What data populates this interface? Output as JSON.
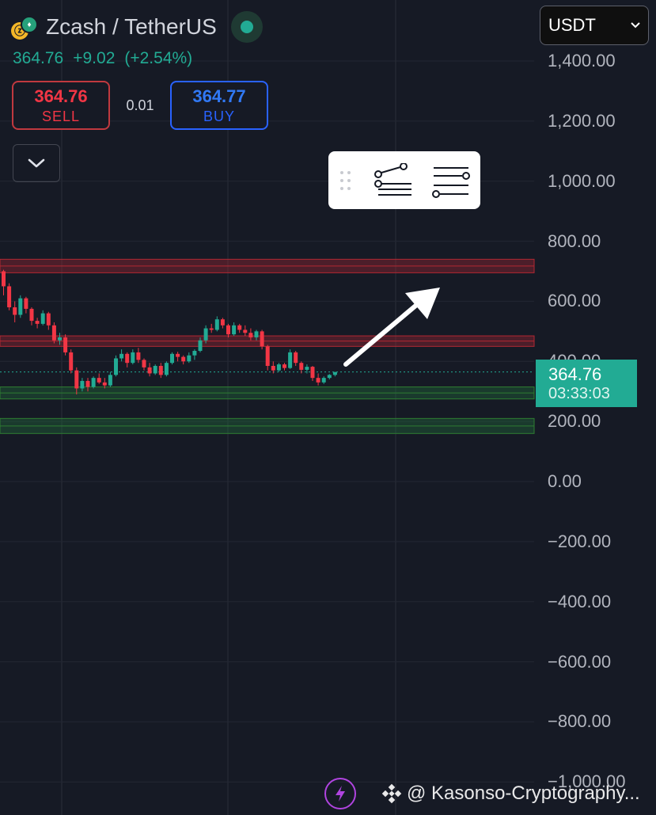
{
  "header": {
    "pair_title": "Zcash / TetherUS",
    "icons": {
      "base_coin": "zcash-coin-icon",
      "quote_coin": "tether-coin-icon",
      "market_status": "market-open-dot-icon"
    }
  },
  "price_line": {
    "last": "364.76",
    "change": "+9.02",
    "change_pct": "(+2.54%)"
  },
  "trade": {
    "sell_price": "364.76",
    "sell_label": "SELL",
    "spread": "0.01",
    "buy_price": "364.77",
    "buy_label": "BUY"
  },
  "currency_select": {
    "value": "USDT"
  },
  "y_axis": {
    "labels": [
      "1,400.00",
      "1,200.00",
      "1,000.00",
      "800.00",
      "600.00",
      "400.00",
      "200.00",
      "0.00",
      "−200.00",
      "−400.00",
      "−600.00",
      "−800.00",
      "−1,000.00"
    ]
  },
  "last_price_tag": {
    "price": "364.76",
    "countdown": "03:33:03"
  },
  "colors": {
    "up": "#22ab94",
    "down": "#f23645",
    "background": "#161a25",
    "buy_border": "#2962ff",
    "sell_border": "#c0393f"
  },
  "footer": {
    "watermark": "@ Kasonso-Cryptography..."
  },
  "chart_data": {
    "type": "candlestick",
    "ylim": [
      -1000,
      1400
    ],
    "last_price": 364.76,
    "resistance_zones": [
      [
        695,
        740
      ],
      [
        450,
        485
      ]
    ],
    "support_zones": [
      [
        275,
        315
      ],
      [
        160,
        210
      ]
    ],
    "candles": [
      [
        700,
        705,
        620,
        650
      ],
      [
        650,
        660,
        570,
        580
      ],
      [
        580,
        600,
        530,
        555
      ],
      [
        555,
        620,
        545,
        610
      ],
      [
        610,
        615,
        560,
        575
      ],
      [
        575,
        580,
        520,
        535
      ],
      [
        535,
        545,
        510,
        525
      ],
      [
        525,
        570,
        520,
        560
      ],
      [
        560,
        565,
        505,
        520
      ],
      [
        520,
        530,
        460,
        470
      ],
      [
        470,
        495,
        455,
        480
      ],
      [
        480,
        490,
        420,
        430
      ],
      [
        430,
        440,
        360,
        370
      ],
      [
        370,
        380,
        290,
        310
      ],
      [
        310,
        345,
        300,
        335
      ],
      [
        335,
        345,
        300,
        315
      ],
      [
        315,
        350,
        310,
        345
      ],
      [
        345,
        360,
        325,
        330
      ],
      [
        330,
        345,
        310,
        320
      ],
      [
        320,
        365,
        315,
        355
      ],
      [
        355,
        420,
        350,
        410
      ],
      [
        410,
        440,
        400,
        425
      ],
      [
        425,
        430,
        380,
        395
      ],
      [
        395,
        440,
        390,
        430
      ],
      [
        430,
        445,
        395,
        405
      ],
      [
        405,
        410,
        370,
        380
      ],
      [
        380,
        395,
        350,
        360
      ],
      [
        360,
        390,
        355,
        385
      ],
      [
        385,
        395,
        345,
        355
      ],
      [
        355,
        400,
        350,
        395
      ],
      [
        395,
        430,
        390,
        425
      ],
      [
        425,
        432,
        400,
        415
      ],
      [
        415,
        420,
        390,
        400
      ],
      [
        400,
        430,
        395,
        420
      ],
      [
        420,
        440,
        405,
        435
      ],
      [
        435,
        480,
        430,
        470
      ],
      [
        470,
        520,
        460,
        510
      ],
      [
        510,
        525,
        495,
        505
      ],
      [
        505,
        550,
        500,
        540
      ],
      [
        540,
        545,
        510,
        520
      ],
      [
        520,
        525,
        480,
        490
      ],
      [
        490,
        530,
        485,
        520
      ],
      [
        520,
        525,
        495,
        505
      ],
      [
        505,
        520,
        485,
        495
      ],
      [
        495,
        510,
        470,
        480
      ],
      [
        480,
        505,
        470,
        500
      ],
      [
        500,
        505,
        440,
        450
      ],
      [
        450,
        455,
        370,
        385
      ],
      [
        385,
        400,
        360,
        370
      ],
      [
        370,
        395,
        365,
        390
      ],
      [
        390,
        395,
        370,
        378
      ],
      [
        378,
        440,
        375,
        430
      ],
      [
        430,
        435,
        385,
        395
      ],
      [
        395,
        400,
        360,
        372
      ],
      [
        372,
        390,
        360,
        382
      ],
      [
        382,
        385,
        335,
        345
      ],
      [
        345,
        360,
        320,
        330
      ],
      [
        330,
        350,
        325,
        345
      ],
      [
        345,
        358,
        340,
        355
      ],
      [
        355,
        365,
        350,
        364.76
      ]
    ]
  }
}
